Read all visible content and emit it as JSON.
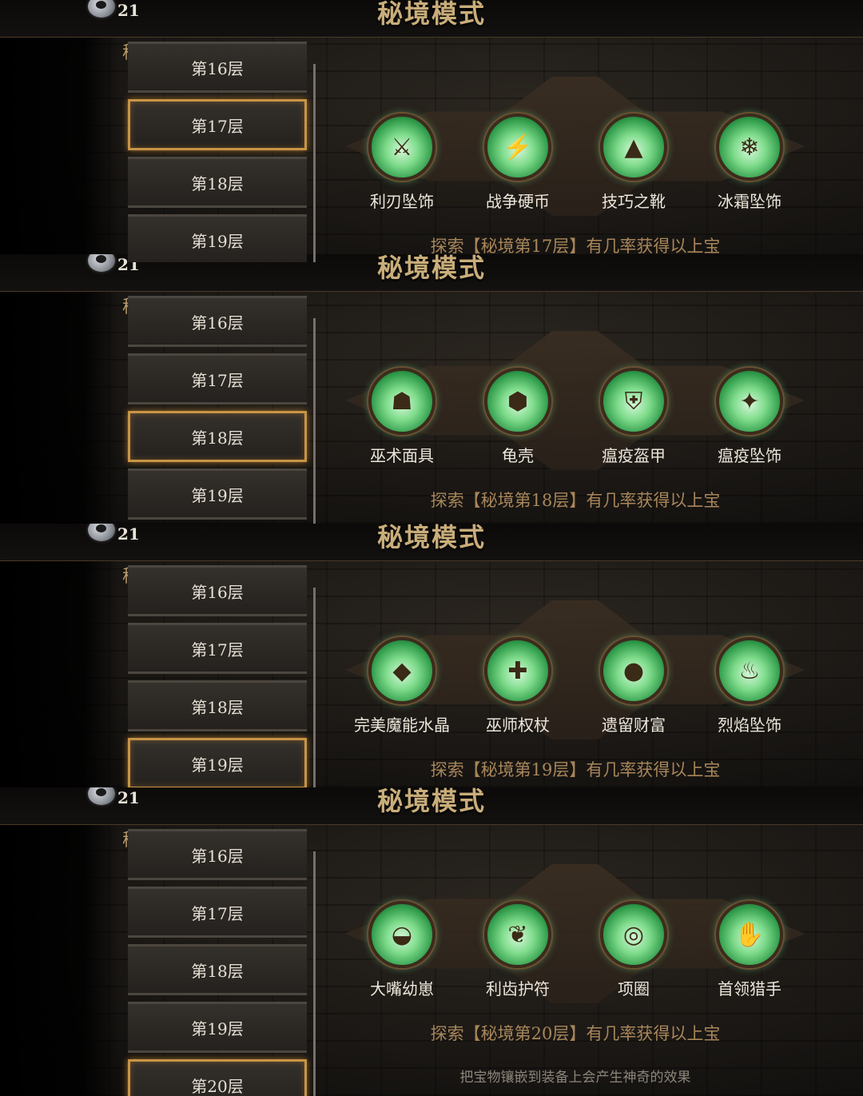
{
  "panels": [
    {
      "coins": "21",
      "title": "秘境模式",
      "realm_label": "秘境",
      "floors": [
        "第16层",
        "第17层",
        "第18层",
        "第19层"
      ],
      "selected_floor": "第17层",
      "items": [
        {
          "name": "利刃坠饰",
          "icon": "blade-pendant-icon"
        },
        {
          "name": "战争硬币",
          "icon": "war-coin-icon"
        },
        {
          "name": "技巧之靴",
          "icon": "boots-icon"
        },
        {
          "name": "冰霜坠饰",
          "icon": "frost-pendant-icon"
        }
      ],
      "hint": "探索【秘境第17层】有几率获得以上宝"
    },
    {
      "coins": "21",
      "title": "秘境模式",
      "realm_label": "秘境",
      "floors": [
        "第16层",
        "第17层",
        "第18层",
        "第19层"
      ],
      "selected_floor": "第18层",
      "items": [
        {
          "name": "巫术面具",
          "icon": "mask-icon"
        },
        {
          "name": "龟壳",
          "icon": "turtle-shell-icon"
        },
        {
          "name": "瘟疫盔甲",
          "icon": "armor-icon"
        },
        {
          "name": "瘟疫坠饰",
          "icon": "plague-pendant-icon"
        }
      ],
      "hint": "探索【秘境第18层】有几率获得以上宝"
    },
    {
      "coins": "21",
      "title": "秘境模式",
      "realm_label": "秘境",
      "floors": [
        "第16层",
        "第17层",
        "第18层",
        "第19层"
      ],
      "selected_floor": "第19层",
      "items": [
        {
          "name": "完美魔能水晶",
          "icon": "crystal-icon"
        },
        {
          "name": "巫师权杖",
          "icon": "scepter-icon"
        },
        {
          "name": "遗留财富",
          "icon": "treasure-bag-icon"
        },
        {
          "name": "烈焰坠饰",
          "icon": "flame-pendant-icon"
        }
      ],
      "hint": "探索【秘境第19层】有几率获得以上宝"
    },
    {
      "coins": "21",
      "title": "秘境模式",
      "realm_label": "秘境",
      "floors": [
        "第16层",
        "第17层",
        "第18层",
        "第19层",
        "第20层"
      ],
      "selected_floor": "第20层",
      "items": [
        {
          "name": "大嘴幼崽",
          "icon": "creature-icon"
        },
        {
          "name": "利齿护符",
          "icon": "tooth-amulet-icon"
        },
        {
          "name": "项圈",
          "icon": "collar-icon"
        },
        {
          "name": "首领猎手",
          "icon": "gauntlet-icon"
        }
      ],
      "hint": "探索【秘境第20层】有几率获得以上宝",
      "subhint": "把宝物镶嵌到装备上会产生神奇的效果"
    }
  ]
}
